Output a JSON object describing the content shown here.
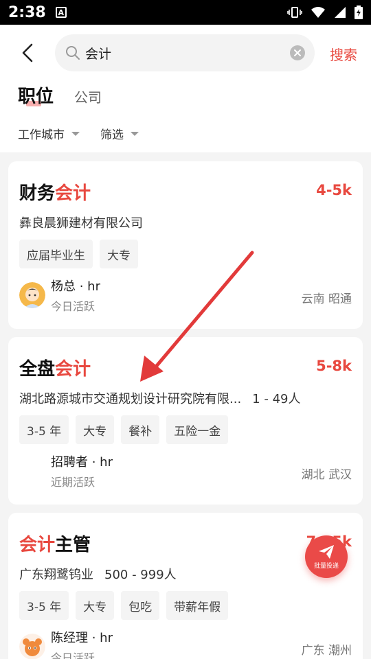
{
  "status": {
    "time": "2:38",
    "a_badge": "A"
  },
  "search": {
    "query": "会计",
    "button": "搜索"
  },
  "tabs": {
    "active": "职位",
    "other": "公司"
  },
  "filters": {
    "city": "工作城市",
    "filter": "筛选"
  },
  "jobs": [
    {
      "title_plain": "财务",
      "title_highlight": "会计",
      "salary": "4-5k",
      "company": "彝良晨狮建材有限公司",
      "size": "",
      "tags": [
        "应届毕业生",
        "大专"
      ],
      "recruiter": "杨总 · hr",
      "active": "今日活跃",
      "location": "云南 昭通"
    },
    {
      "title_plain": "全盘",
      "title_highlight": "会计",
      "salary": "5-8k",
      "company": "湖北路源城市交通规划设计研究院有限...",
      "size": "1 - 49人",
      "tags": [
        "3-5 年",
        "大专",
        "餐补",
        "五险一金"
      ],
      "recruiter": "招聘者 · hr",
      "active": "近期活跃",
      "location": "湖北 武汉"
    },
    {
      "title_highlight": "会计",
      "title_plain": "主管",
      "salary": "7-15k",
      "company": "广东翔鹭钨业",
      "size": "500 - 999人",
      "tags": [
        "3-5 年",
        "大专",
        "包吃",
        "带薪年假"
      ],
      "recruiter": "陈经理 · hr",
      "active": "今日活跃",
      "location": "广东 潮州"
    }
  ],
  "fab": {
    "label": "批量投递"
  },
  "colors": {
    "accent": "#e8483f"
  }
}
